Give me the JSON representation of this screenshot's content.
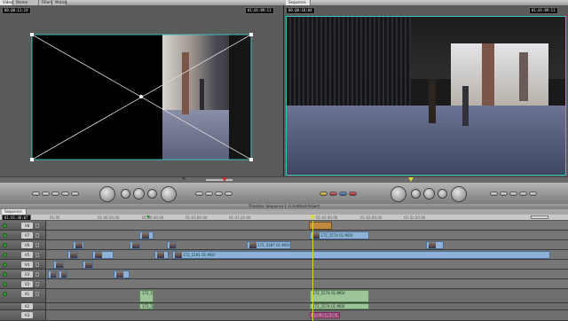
{
  "viewer": {
    "tabs": [
      "Video",
      "Stereo (a1a2)",
      "Filters",
      "Motion"
    ],
    "timecode_left": "00:00:11:19",
    "timecode_right": "01:01:09:11"
  },
  "canvas": {
    "tab": "Sequence 1",
    "timecode_left": "00:00:18:04",
    "timecode_right": "01:01:09:11"
  },
  "timeline": {
    "tab": "Sequence 1",
    "title": "Timeline: Sequence 1 in Untitled Project",
    "current_time": "01:01:48:07",
    "ruler": [
      "01:00",
      "01:00:20:00",
      "01:00:40:00",
      "01:01:00:00",
      "01:01:20:00",
      "01:01:40:00",
      "01:02:00:00",
      "01:02:20:00"
    ],
    "video_tracks": [
      "V8",
      "V7",
      "V6",
      "V5",
      "V4",
      "V3",
      "V2",
      "V1"
    ],
    "audio_tracks": [
      "A1",
      "A2",
      "A3"
    ],
    "clips": {
      "v7_a": "172_1574 01.MOV",
      "v5_a": "172_3187 01.MOV",
      "v3_a": "172_2191 01.MOV",
      "a1_a": "172_1568 01.MOV",
      "a1_b": "172_1574 01.MOV",
      "a2_a": "172_1568 01.MOV",
      "a2_b": "172_1574 01.MOV",
      "a3_a": "172_1574 01.MOV"
    }
  },
  "colors": {
    "accent": "#3fbfbf",
    "playhead": "#d9d92a",
    "video_clip": "#8fb1d8",
    "audio_clip": "#9ec49a"
  }
}
